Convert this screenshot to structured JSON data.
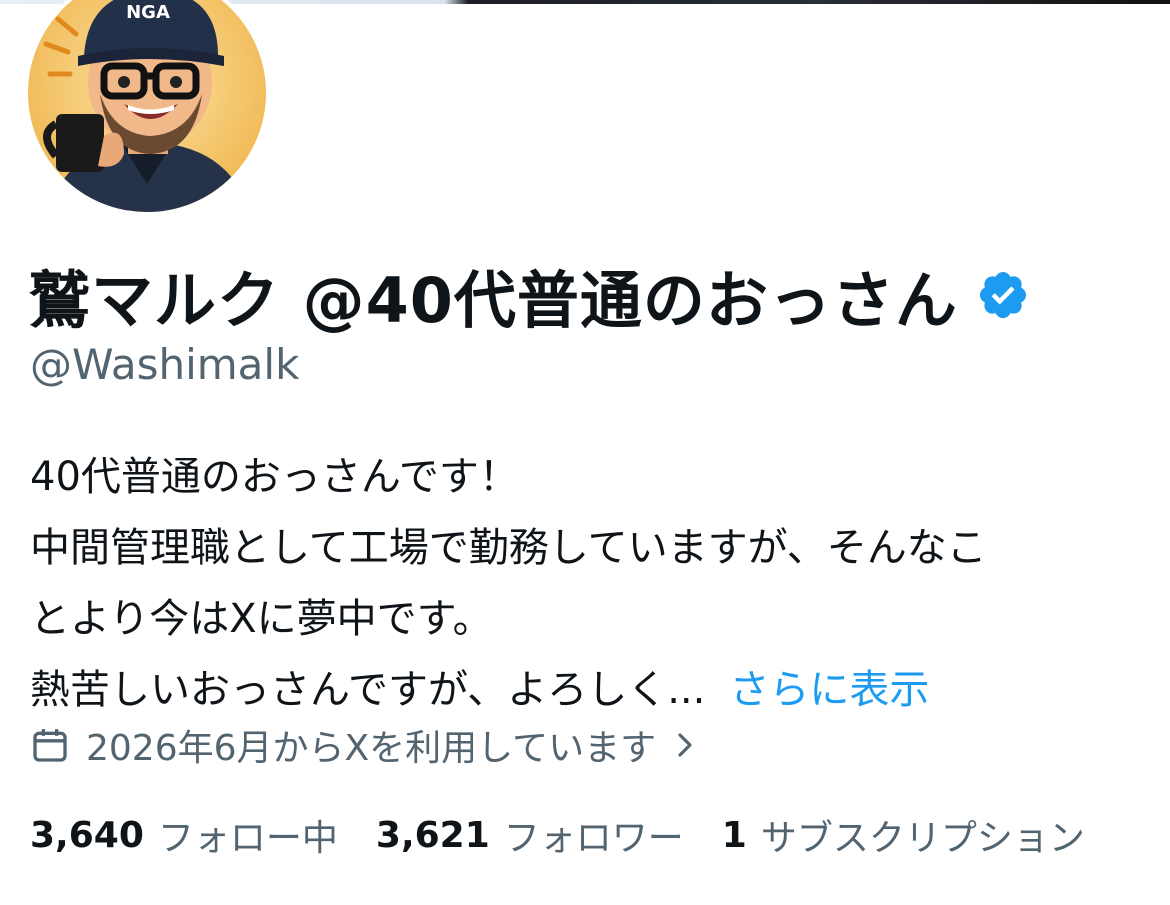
{
  "profile": {
    "display_name": "鷲マルク @40代普通のおっさん",
    "handle": "@Washimalk",
    "verified": true,
    "verified_color": "#1d9bf0",
    "avatar_cap_text": "NGA",
    "bio_lines": [
      "40代普通のおっさんです！",
      "中間管理職として工場で勤務していますが、そんなこ",
      "とより今はXに夢中です。",
      "熱苦しいおっさんですが、よろしく..."
    ],
    "show_more": "さらに表示",
    "joined": "2026年6月からXを利用しています",
    "stats": {
      "following_count": "3,640",
      "following_label": "フォロー中",
      "followers_count": "3,621",
      "followers_label": "フォロワー",
      "subscriptions_count": "1",
      "subscriptions_label": "サブスクリプション"
    }
  },
  "colors": {
    "text_primary": "#0f1419",
    "text_secondary": "#536471",
    "link": "#1d9bf0"
  },
  "icons": {
    "calendar": "calendar-icon",
    "chevron": "chevron-right-icon",
    "verified": "verified-badge-icon"
  }
}
